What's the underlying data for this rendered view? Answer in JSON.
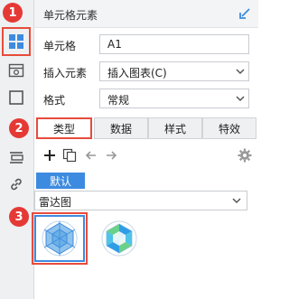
{
  "panel": {
    "title": "单元格元素"
  },
  "fields": {
    "cell": {
      "label": "单元格",
      "value": "A1"
    },
    "insert": {
      "label": "插入元素",
      "value": "插入图表(C)"
    },
    "format": {
      "label": "格式",
      "value": "常规"
    }
  },
  "tabs": [
    {
      "label": "类型"
    },
    {
      "label": "数据"
    },
    {
      "label": "样式"
    },
    {
      "label": "特效"
    }
  ],
  "chart": {
    "default_label": "默认",
    "type_value": "雷达图"
  },
  "badges": {
    "one": "1",
    "two": "2",
    "three": "3"
  },
  "colors": {
    "accent": "#3d8be0",
    "highlight": "#e74c3c",
    "badge": "#e53935"
  },
  "icons": [
    "grid-icon",
    "cell-attr-icon",
    "border-icon",
    "widget-icon",
    "link-icon",
    "pin-icon",
    "add-icon",
    "copy-icon",
    "arrow-left-icon",
    "arrow-right-icon",
    "gear-icon",
    "dropdown-icon",
    "radar-thumb-icon",
    "filled-radar-thumb-icon"
  ]
}
